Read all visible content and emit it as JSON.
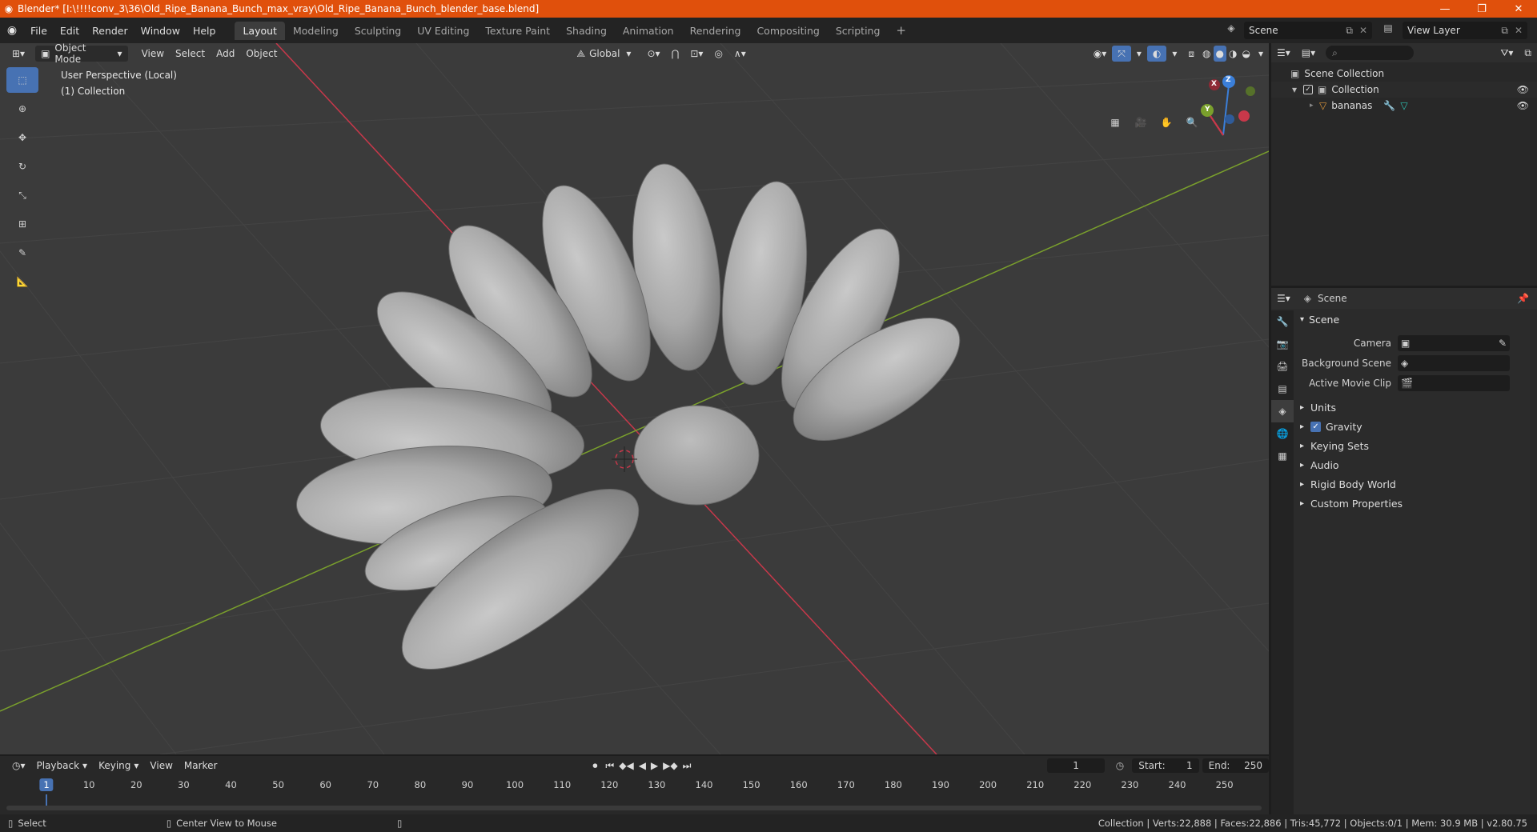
{
  "window": {
    "title": "Blender* [I:\\!!!!conv_3\\36\\Old_Ripe_Banana_Bunch_max_vray\\Old_Ripe_Banana_Bunch_blender_base.blend]",
    "minimize": "—",
    "maximize": "❐",
    "close": "✕"
  },
  "menu": [
    "File",
    "Edit",
    "Render",
    "Window",
    "Help"
  ],
  "workspaces": [
    "Layout",
    "Modeling",
    "Sculpting",
    "UV Editing",
    "Texture Paint",
    "Shading",
    "Animation",
    "Rendering",
    "Compositing",
    "Scripting"
  ],
  "workspace_add": "+",
  "scene_selector": "Scene",
  "view_layer": "View Layer",
  "viewport": {
    "mode": "Object Mode",
    "menus": [
      "View",
      "Select",
      "Add",
      "Object"
    ],
    "orientation": "Global",
    "info_line1": "User Perspective (Local)",
    "info_line2": "(1) Collection",
    "gizmo": {
      "x": "X",
      "y": "Y",
      "z": "Z"
    }
  },
  "outliner": {
    "root": "Scene Collection",
    "collection": "Collection",
    "object": "bananas"
  },
  "properties": {
    "header": "Scene",
    "panel": "Scene",
    "rows": {
      "camera": "Camera",
      "background_scene": "Background Scene",
      "active_movie_clip": "Active Movie Clip"
    },
    "subpanels": {
      "units": "Units",
      "gravity": "Gravity",
      "keying_sets": "Keying Sets",
      "audio": "Audio",
      "rigid_body_world": "Rigid Body World",
      "custom_properties": "Custom Properties"
    }
  },
  "timeline": {
    "menus": [
      "Playback",
      "Keying",
      "View",
      "Marker"
    ],
    "current_frame": "1",
    "start_label": "Start:",
    "start": "1",
    "end_label": "End:",
    "end": "250",
    "ruler": [
      "1",
      "10",
      "20",
      "30",
      "40",
      "50",
      "60",
      "70",
      "80",
      "90",
      "100",
      "110",
      "120",
      "130",
      "140",
      "150",
      "160",
      "170",
      "180",
      "190",
      "200",
      "210",
      "220",
      "230",
      "240",
      "250"
    ]
  },
  "statusbar": {
    "select": "Select",
    "center_view": "Center View to Mouse",
    "stats": "Collection | Verts:22,888 | Faces:22,886 | Tris:45,772 | Objects:0/1 | Mem: 30.9 MB | v2.80.75"
  },
  "colors": {
    "titlebar": "#e0500c",
    "accent": "#4772b3",
    "viewport_bg": "#3b3b3b",
    "x_axis": "#c8384a",
    "y_axis": "#7aa02c",
    "z_axis": "#3b7fd9"
  }
}
